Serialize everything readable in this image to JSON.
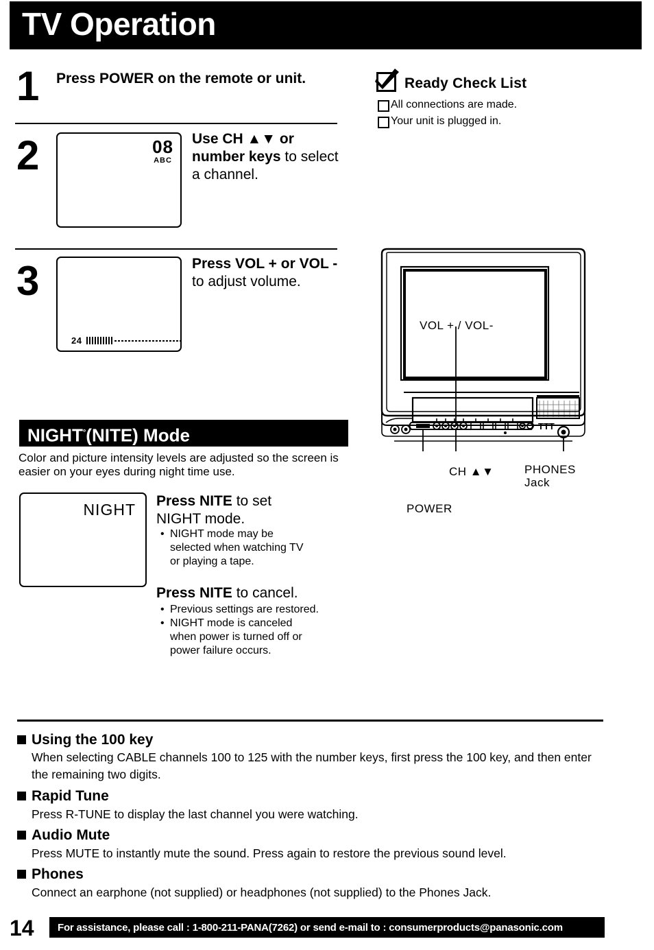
{
  "header": {
    "title": "TV Operation"
  },
  "steps": [
    {
      "number": "1",
      "instruction_bold": "Press POWER on the remote or unit.",
      "instruction_rest": ""
    },
    {
      "number": "2",
      "instruction_bold": "Use CH ▲▼ or number keys",
      "instruction_rest": " to select a channel.",
      "screen": {
        "channel": "08",
        "source": "ABC"
      }
    },
    {
      "number": "3",
      "instruction_bold": "Press VOL + or VOL -",
      "instruction_rest": " to adjust volume.",
      "screen": {
        "volume_value": "24"
      }
    }
  ],
  "ready_check": {
    "title": "Ready Check List",
    "checkbox_icon": "checked-box-icon",
    "items": [
      "All connections are made.",
      "Your unit is plugged in."
    ]
  },
  "night_mode": {
    "bar_title_main": "NIGHT",
    "bar_title_sup": "°",
    "bar_title_rest": "(NITE) Mode",
    "description": "Color and picture intensity levels are adjusted so the screen is easier on your eyes during night time use.",
    "screen_osd": "NIGHT",
    "set_head_bold": "Press NITE",
    "set_head_rest": " to set",
    "set_head_line2": "NIGHT mode.",
    "set_bullets": [
      "NIGHT mode may be",
      "selected when watching TV",
      "or playing a tape."
    ],
    "cancel_head_bold": "Press NITE",
    "cancel_head_rest": " to cancel.",
    "cancel_bullets": [
      "Previous settings are restored.",
      "NIGHT mode is canceled",
      "when power is turned off or",
      "power failure occurs."
    ]
  },
  "tv_diagram": {
    "labels": {
      "vol": "VOL + / VOL-",
      "ch": "CH ▲▼",
      "phones_line1": "PHONES",
      "phones_line2": "Jack",
      "power": "POWER"
    }
  },
  "notes": [
    {
      "heading": "Using the 100 key",
      "body": "When selecting CABLE channels 100 to 125 with the number keys, first press the 100 key, and then enter the remaining two digits."
    },
    {
      "heading": "Rapid Tune",
      "body": "Press R-TUNE to display the last channel you were watching."
    },
    {
      "heading": "Audio Mute",
      "body": "Press MUTE to instantly mute the sound. Press again to restore the previous sound level."
    },
    {
      "heading": "Phones",
      "body": "Connect an earphone (not supplied) or headphones (not supplied) to the Phones Jack."
    }
  ],
  "footer": {
    "page_number": "14",
    "text": "For assistance, please call : 1-800-211-PANA(7262) or send e-mail to : consumerproducts@panasonic.com"
  },
  "colors": {
    "ink": "#000000",
    "paper": "#ffffff"
  }
}
